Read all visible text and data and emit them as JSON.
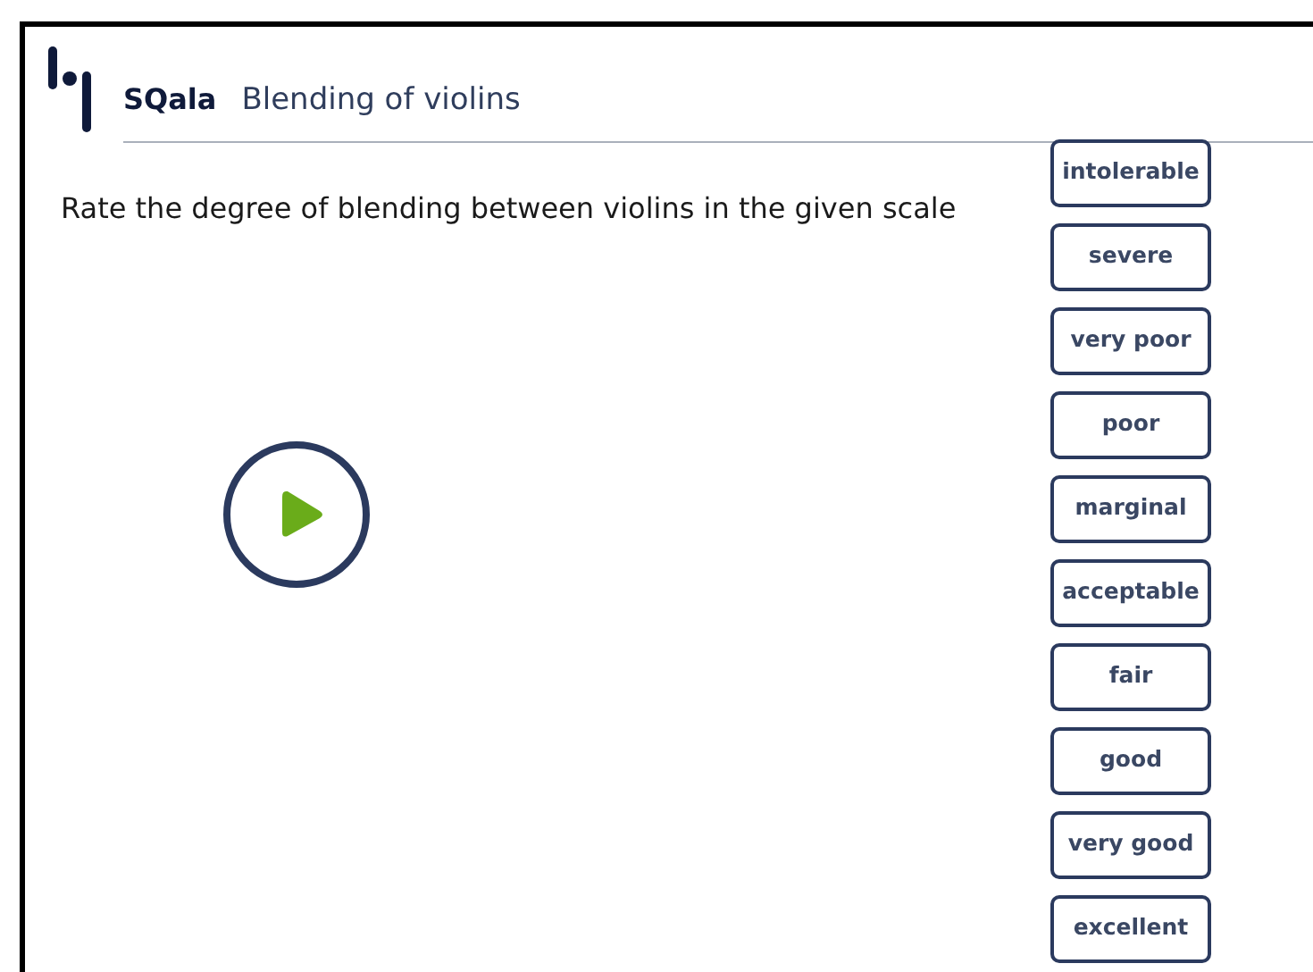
{
  "header": {
    "brand": "SQala",
    "title": "Blending of violins"
  },
  "question": "Rate the degree of blending between violins in the given scale",
  "scale": [
    "intolerable",
    "severe",
    "very poor",
    "poor",
    "marginal",
    "acceptable",
    "fair",
    "good",
    "very good",
    "excellent"
  ]
}
